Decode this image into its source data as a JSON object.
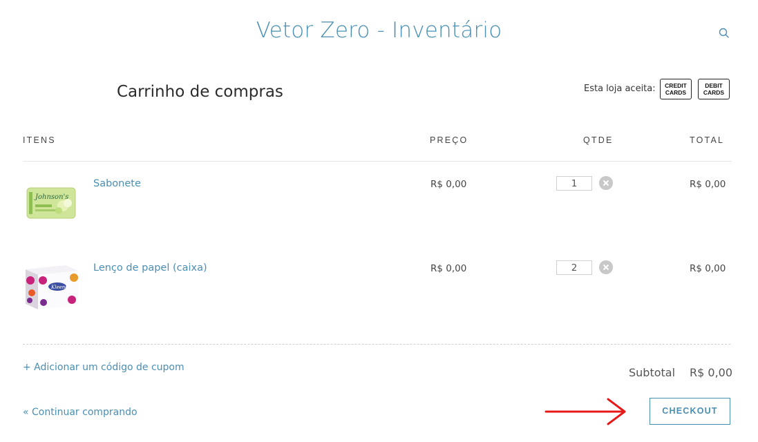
{
  "store": {
    "title": "Vetor Zero - Inventário"
  },
  "cart": {
    "heading": "Carrinho de compras",
    "accepts_label": "Esta loja aceita:",
    "payment_badges": [
      {
        "line1": "CREDIT",
        "line2": "CARDS"
      },
      {
        "line1": "DEBIT",
        "line2": "CARDS"
      }
    ],
    "columns": {
      "items": "ITENS",
      "price": "PREÇO",
      "qty": "QTDE",
      "total": "TOTAL"
    },
    "items": [
      {
        "name": "Sabonete",
        "price": "R$ 0,00",
        "qty": "1",
        "total": "R$ 0,00",
        "image_icon": "johnsons-soap-package"
      },
      {
        "name": "Lenço de papel (caixa)",
        "price": "R$ 0,00",
        "qty": "2",
        "total": "R$ 0,00",
        "image_icon": "kleenex-tissue-box"
      }
    ],
    "coupon_link": "+ Adicionar um código de cupom",
    "subtotal_label": "Subtotal",
    "subtotal_value": "R$ 0,00",
    "continue_link": "« Continuar comprando",
    "checkout_label": "CHECKOUT"
  },
  "colors": {
    "accent": "#4a8eb2",
    "annotation_arrow": "#e81818"
  }
}
